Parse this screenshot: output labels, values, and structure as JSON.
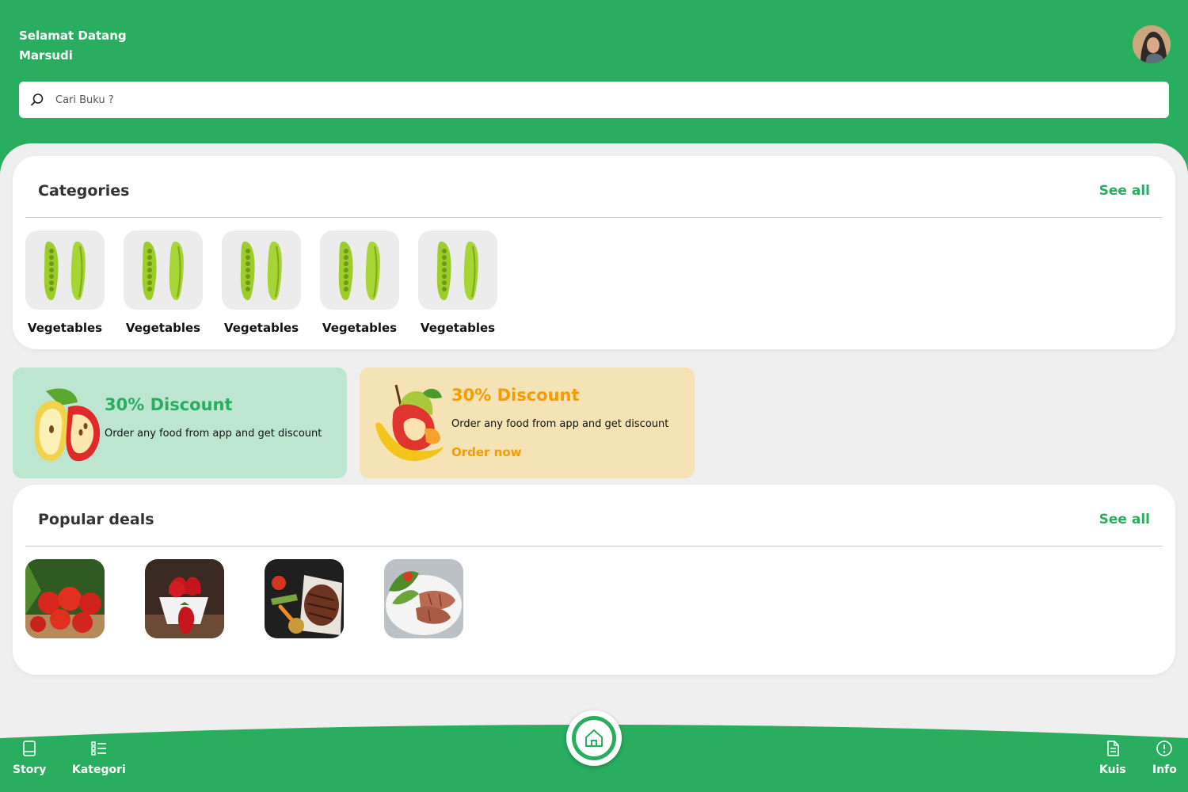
{
  "header": {
    "greeting": "Selamat Datang",
    "user_name": "Marsudi",
    "search_placeholder": "Cari Buku ?"
  },
  "categories": {
    "title": "Categories",
    "see_all": "See all",
    "items": [
      {
        "label": "Vegetables"
      },
      {
        "label": "Vegetables"
      },
      {
        "label": "Vegetables"
      },
      {
        "label": "Vegetables"
      },
      {
        "label": "Vegetables"
      }
    ]
  },
  "promos": [
    {
      "title": "30% Discount",
      "text": "Order any food from app and get discount",
      "color": "#29ae5f"
    },
    {
      "title": "30% Discount",
      "text": "Order any food from app and get discount",
      "cta": "Order now",
      "color": "#f59d00"
    }
  ],
  "popular": {
    "title": "Popular deals",
    "see_all": "See all"
  },
  "nav": {
    "story": "Story",
    "kategori": "Kategori",
    "kuis": "Kuis",
    "info": "Info"
  },
  "colors": {
    "brand_green": "#29ae5f",
    "accent_orange": "#f59d00"
  }
}
